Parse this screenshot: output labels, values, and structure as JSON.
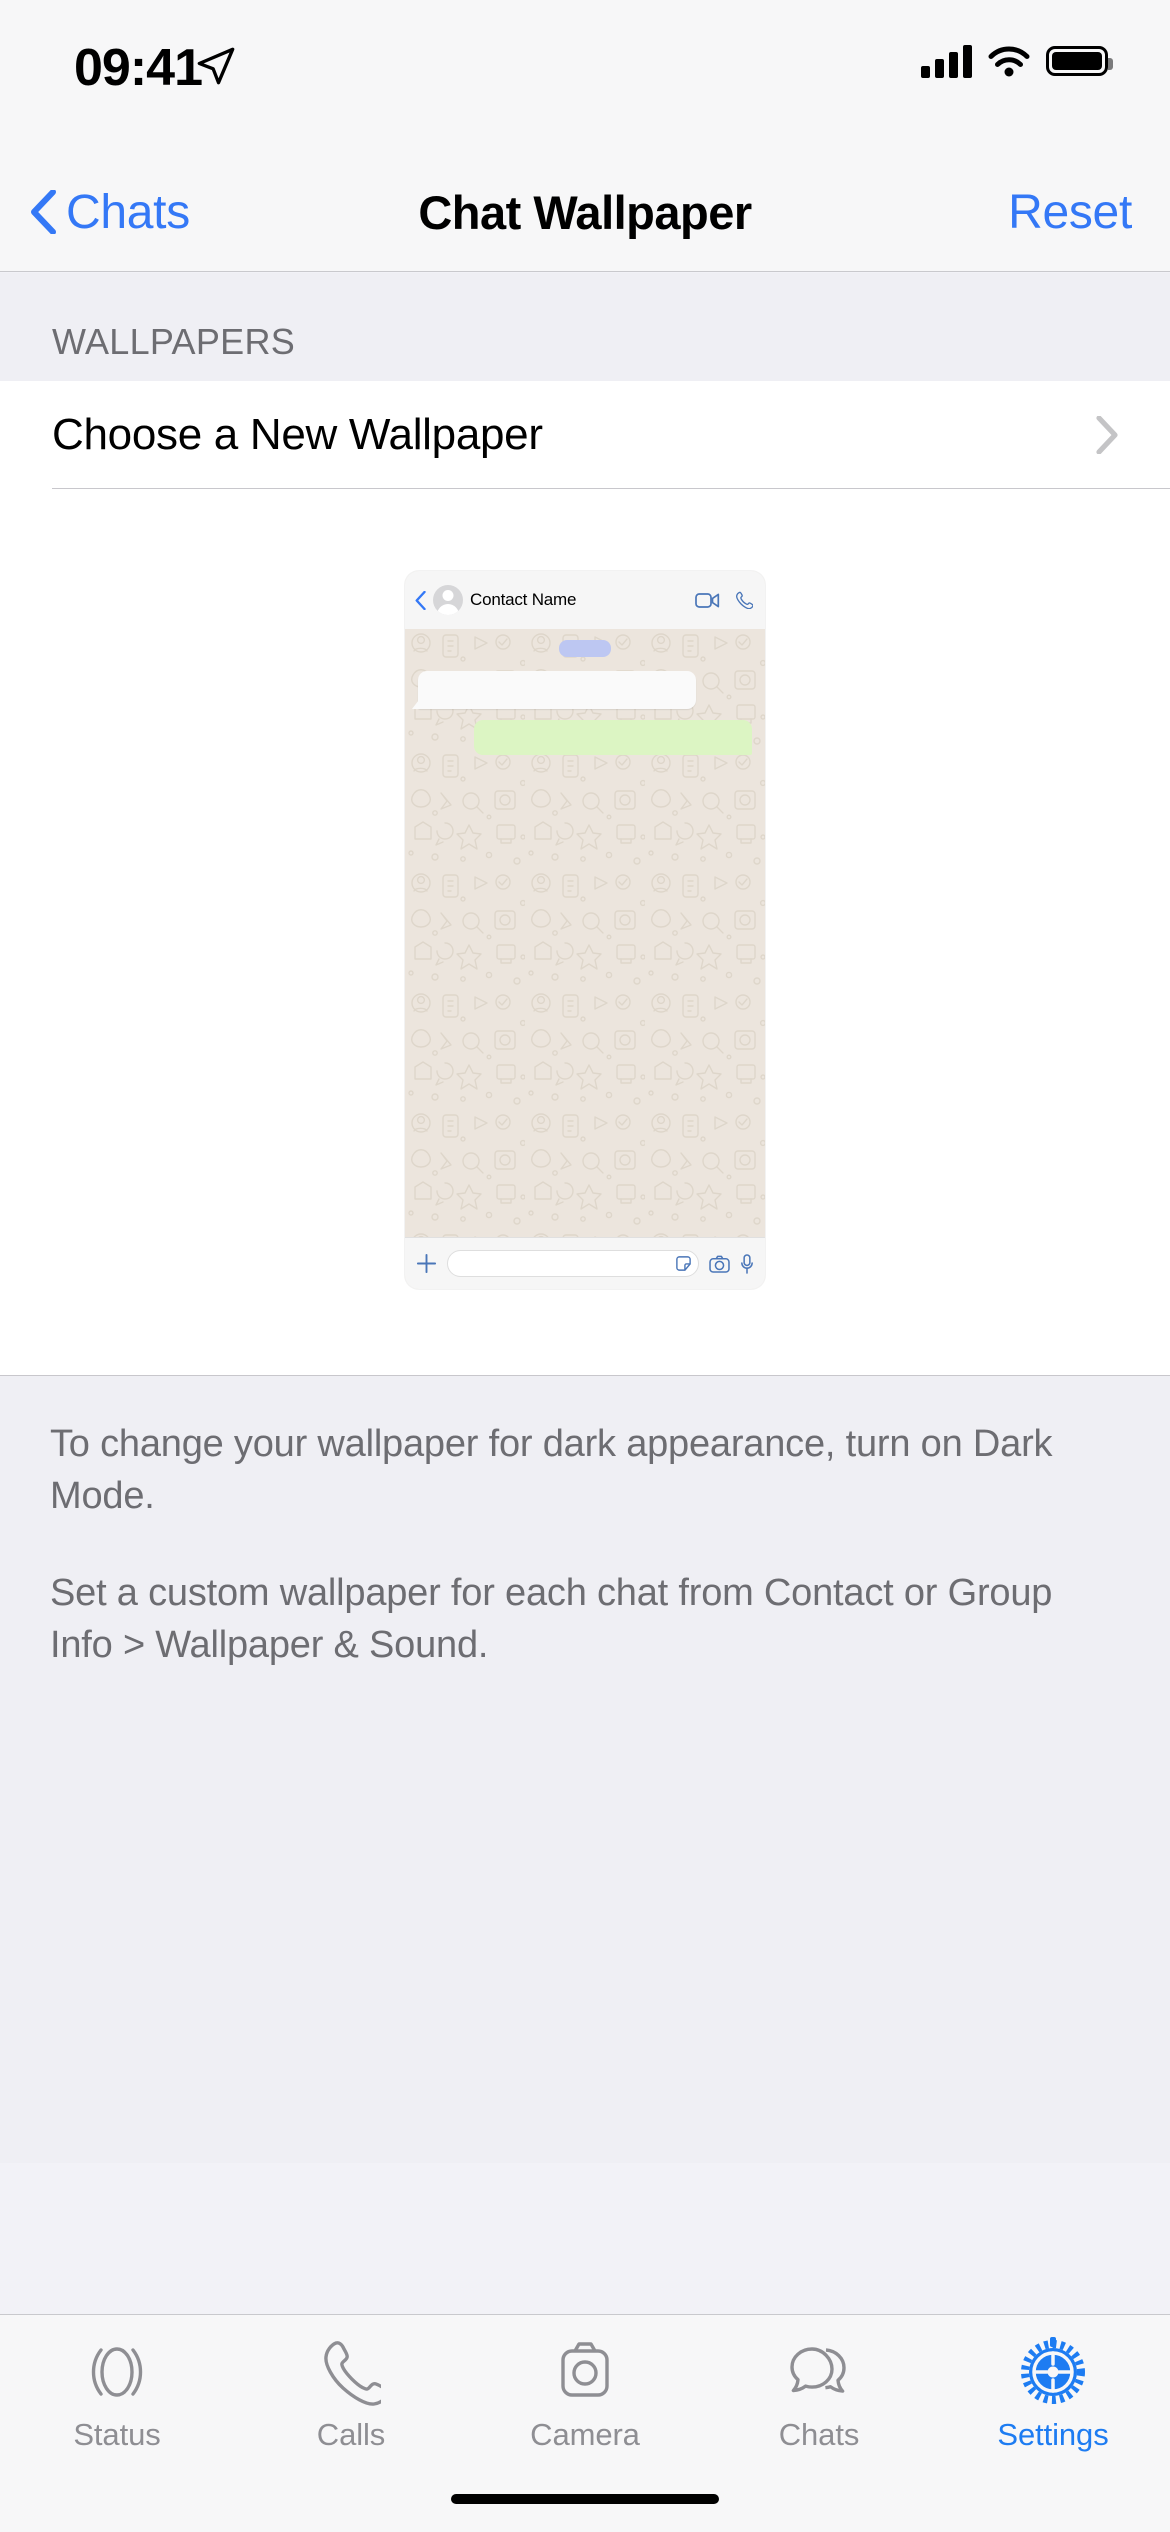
{
  "status_bar": {
    "time": "09:41",
    "location_icon": "location-arrow-icon",
    "signal_icon": "cellular-signal-icon",
    "wifi_icon": "wifi-icon",
    "battery_icon": "battery-full-icon"
  },
  "nav": {
    "back_label": "Chats",
    "back_icon": "chevron-left-icon",
    "title": "Chat Wallpaper",
    "action_label": "Reset"
  },
  "sections": {
    "wallpapers_header": "WALLPAPERS",
    "choose_row_label": "Choose a New Wallpaper",
    "choose_row_chevron": "chevron-right-icon"
  },
  "preview": {
    "back_icon": "chevron-left-icon",
    "avatar_icon": "person-placeholder-avatar",
    "contact_name": "Contact Name",
    "video_call_icon": "video-camera-icon",
    "voice_call_icon": "phone-icon",
    "date_pill": "",
    "incoming_bubble": "",
    "outgoing_bubble": "",
    "input_plus_icon": "plus-icon",
    "input_placeholder": "",
    "sticker_icon": "sticker-icon",
    "camera_icon": "camera-icon",
    "mic_icon": "microphone-icon"
  },
  "footnote": {
    "line1": "To change your wallpaper for dark appearance, turn on Dark Mode.",
    "line2": "Set a custom wallpaper for each chat from Contact or Group Info > Wallpaper & Sound."
  },
  "tabbar": {
    "items": [
      {
        "label": "Status",
        "icon": "status-rings-icon",
        "active": false
      },
      {
        "label": "Calls",
        "icon": "phone-icon",
        "active": false
      },
      {
        "label": "Camera",
        "icon": "camera-icon",
        "active": false
      },
      {
        "label": "Chats",
        "icon": "chat-bubbles-icon",
        "active": false
      },
      {
        "label": "Settings",
        "icon": "gear-icon",
        "active": true
      }
    ]
  },
  "colors": {
    "tint_blue": "#3478F6",
    "tab_active_blue": "#1D7CF2",
    "tab_inactive_gray": "#8E8E93",
    "group_bg": "#EFEFF4",
    "wallpaper_beige": "#ECE5DD",
    "outgoing_green": "#DCF5C3",
    "date_pill_lavender": "#BDC7F2"
  }
}
